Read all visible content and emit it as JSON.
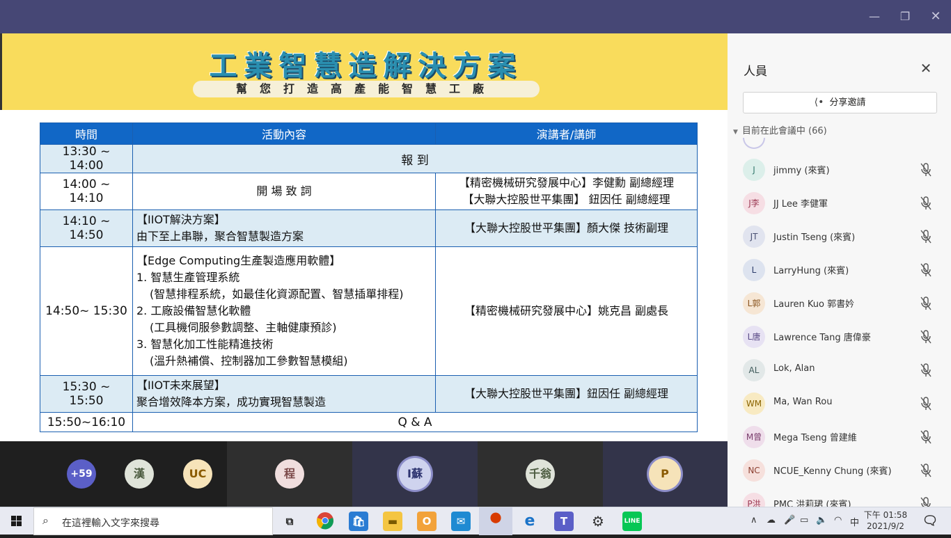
{
  "window": {
    "minimize_icon": "minimize-icon",
    "maximize_icon": "maximize-icon",
    "close_icon": "close-icon"
  },
  "slide": {
    "title": "工業智慧造解決方案",
    "subtitle": "幫您打造高產能智慧工廠",
    "table": {
      "headers": [
        "時間",
        "活動內容",
        "演講者/講師"
      ],
      "rows": [
        {
          "time": "13:30 ~ 14:00",
          "merged": "報 到"
        },
        {
          "time": "14:00 ~ 14:10",
          "activity": [
            "開 場 致 詞"
          ],
          "speaker": [
            "【精密機械研究發展中心】李健勳 副總經理",
            "【大聯大控股世平集團】 鈕因任  副總經理"
          ]
        },
        {
          "time": "14:10 ~ 14:50",
          "activity": [
            "【IIOT解決方案】",
            "由下至上串聯，聚合智慧製造方案"
          ],
          "speaker": [
            "【大聯大控股世平集團】顏大傑 技術副理"
          ]
        },
        {
          "time": "14:50~ 15:30",
          "activity": [
            "【Edge Computing生產製造應用軟體】",
            "1. 智慧生產管理系統",
            "(智慧排程系統，如最佳化資源配置、智慧插單排程)",
            "2. 工廠設備智慧化軟體",
            "(工具機伺服參數調整、主軸健康預診)",
            "3. 智慧化加工性能精進技術",
            "(溫升熱補償、控制器加工參數智慧模組)"
          ],
          "speaker": [
            "【精密機械研究發展中心】姚克昌 副處長"
          ]
        },
        {
          "time": "15:30 ~ 15:50",
          "activity": [
            "【IIOT未來展望】",
            "聚合增效降本方案，成功實現智慧製造"
          ],
          "speaker": [
            "【大聯大控股世平集團】鈕因任 副總經理"
          ]
        },
        {
          "time": "15:50~16:10",
          "merged": "Q & A"
        }
      ]
    }
  },
  "gallery": {
    "overflow_count": "+59",
    "avatars": [
      {
        "initials": "漢",
        "bg": "#dfe3d9",
        "fg": "#4b5a3f"
      },
      {
        "initials": "UC",
        "bg": "#f6e3b9",
        "fg": "#8a5a00"
      },
      {
        "initials": "程",
        "bg": "#f0dede",
        "fg": "#7a4848"
      },
      {
        "initials": "I蘇",
        "bg": "#cfd3ee",
        "fg": "#2e3470"
      },
      {
        "initials": "千翁",
        "bg": "#dfe3d9",
        "fg": "#4b5a3f"
      },
      {
        "initials": "P",
        "bg": "#f6e3b9",
        "fg": "#8a5a00"
      }
    ]
  },
  "people_panel": {
    "title": "人員",
    "share_label": "分享邀請",
    "section_label": "目前在此會議中 (66)",
    "people": [
      {
        "initials": "J",
        "name": "jimmy (來賓)",
        "bg": "#dcefea",
        "fg": "#357a6e"
      },
      {
        "initials": "J李",
        "name": "JJ Lee 李健軍",
        "bg": "#f6dee4",
        "fg": "#9c3b54"
      },
      {
        "initials": "JT",
        "name": "Justin Tseng (來賓)",
        "bg": "#e1e4ef",
        "fg": "#4a5173"
      },
      {
        "initials": "L",
        "name": "LarryHung (來賓)",
        "bg": "#dde3ef",
        "fg": "#2d3d6b"
      },
      {
        "initials": "L郭",
        "name": "Lauren Kuo 郭書妗",
        "bg": "#f6e6d4",
        "fg": "#8a5520"
      },
      {
        "initials": "L唐",
        "name": "Lawrence Tang 唐偉豪",
        "bg": "#e7e2f3",
        "fg": "#5a4a86"
      },
      {
        "initials": "AL",
        "name": "Lok, Alan",
        "bg": "#e2e8e8",
        "fg": "#3f5a5a"
      },
      {
        "initials": "WM",
        "name": "Ma, Wan Rou",
        "bg": "#f8eac2",
        "fg": "#8a6300"
      },
      {
        "initials": "M曾",
        "name": "Mega Tseng 曾建維",
        "bg": "#efdeeb",
        "fg": "#7a3d6c"
      },
      {
        "initials": "NC",
        "name": "NCUE_Kenny Chung (來賓)",
        "bg": "#f6e0dc",
        "fg": "#8c3f30"
      },
      {
        "initials": "P洪",
        "name": "PMC 洪莉珺 (來賓)",
        "bg": "#f6dee4",
        "fg": "#9c3b54"
      }
    ]
  },
  "taskbar": {
    "search_placeholder": "在這裡輸入文字來搜尋",
    "ime_label": "中",
    "time": "下午 01:58",
    "date": "2021/9/2"
  }
}
